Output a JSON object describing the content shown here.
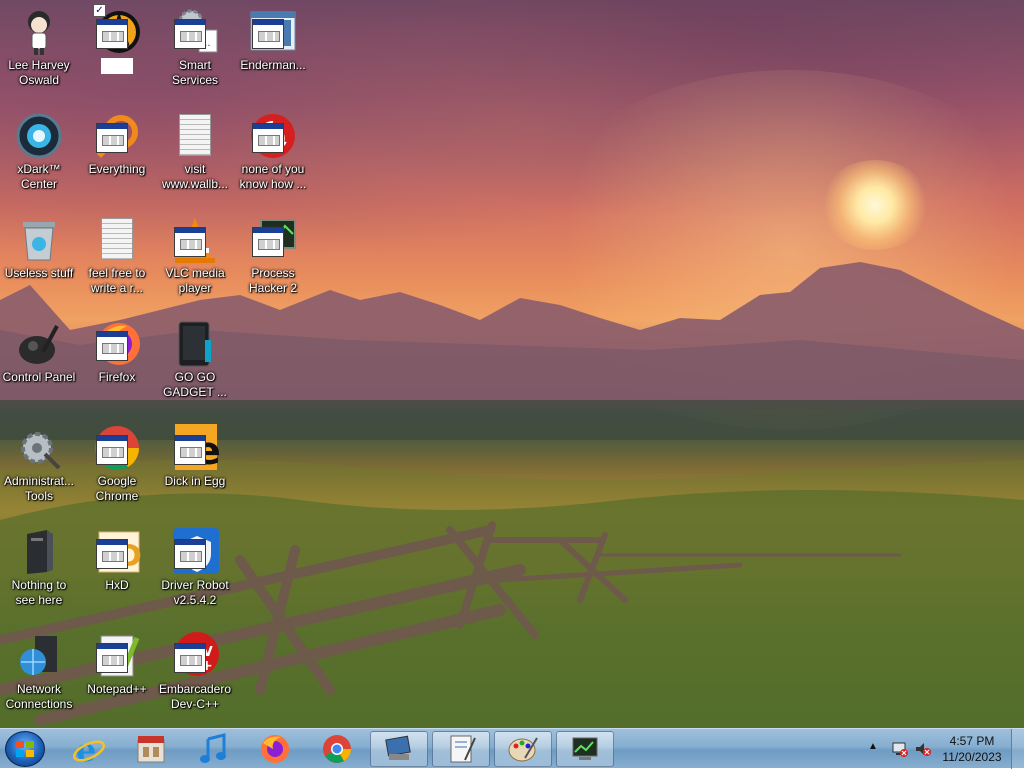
{
  "desktop_icons": [
    {
      "name": "desktop-icon-lee-harvey-oswald",
      "label": "Lee Harvey\nOswald",
      "icon": "anime-character-icon"
    },
    {
      "name": "desktop-icon-unnamed",
      "label": "",
      "icon": "half-life-app-icon"
    },
    {
      "name": "desktop-icon-smart-services",
      "label": "Smart\nServices",
      "icon": "gears-app-icon"
    },
    {
      "name": "desktop-icon-enderman",
      "label": "Enderman...",
      "icon": "window-app-icon"
    },
    {
      "name": "desktop-icon-xdark-center",
      "label": "xDark™\nCenter",
      "icon": "xdark-orb-icon"
    },
    {
      "name": "desktop-icon-everything",
      "label": "Everything",
      "icon": "search-magnifier-icon"
    },
    {
      "name": "desktop-icon-visit-wallb",
      "label": "visit\nwww.wallb...",
      "icon": "text-document-icon"
    },
    {
      "name": "desktop-icon-none-of-you",
      "label": "none of you\nknow how ...",
      "icon": "red-app-icon"
    },
    {
      "name": "desktop-icon-useless-stuff",
      "label": "Useless stuff",
      "icon": "recycle-bin-icon"
    },
    {
      "name": "desktop-icon-feel-free",
      "label": "feel free to\nwrite a r...",
      "icon": "text-document-icon"
    },
    {
      "name": "desktop-icon-vlc",
      "label": "VLC media\nplayer",
      "icon": "vlc-cone-icon"
    },
    {
      "name": "desktop-icon-process-hacker",
      "label": "Process\nHacker 2",
      "icon": "monitor-app-icon"
    },
    {
      "name": "desktop-icon-control-panel",
      "label": "Control Panel",
      "icon": "control-panel-icon"
    },
    {
      "name": "desktop-icon-firefox",
      "label": "Firefox",
      "icon": "firefox-icon"
    },
    {
      "name": "desktop-icon-go-go-gadget",
      "label": "GO GO\nGADGET ...",
      "icon": "gadget-box-icon"
    },
    {
      "name": "desktop-icon-admin-tools",
      "label": "Administrat...\nTools",
      "icon": "admin-gears-icon"
    },
    {
      "name": "desktop-icon-google-chrome",
      "label": "Google\nChrome",
      "icon": "chrome-icon"
    },
    {
      "name": "desktop-icon-dick-in-egg",
      "label": "Dick in Egg",
      "icon": "letter-e-app-icon"
    },
    {
      "name": "desktop-icon-nothing-to-see",
      "label": "Nothing to\nsee here",
      "icon": "pc-tower-icon"
    },
    {
      "name": "desktop-icon-hxd",
      "label": "HxD",
      "icon": "hxd-app-icon"
    },
    {
      "name": "desktop-icon-driver-robot",
      "label": "Driver Robot\nv2.5.4.2",
      "icon": "shield-app-icon"
    },
    {
      "name": "desktop-icon-network-connections",
      "label": "Network\nConnections",
      "icon": "network-globe-icon"
    },
    {
      "name": "desktop-icon-notepad-plus",
      "label": "Notepad++",
      "icon": "notepad-plus-icon"
    },
    {
      "name": "desktop-icon-embarcadero",
      "label": "Embarcadero\nDev-C++",
      "icon": "dev-cpp-icon"
    }
  ],
  "taskbar": {
    "pinned": [
      {
        "name": "taskbar-internet-explorer",
        "icon": "internet-explorer-icon"
      },
      {
        "name": "taskbar-app-store",
        "icon": "store-icon"
      },
      {
        "name": "taskbar-music",
        "icon": "music-note-icon"
      },
      {
        "name": "taskbar-firefox",
        "icon": "firefox-icon"
      },
      {
        "name": "taskbar-chrome",
        "icon": "chrome-icon"
      },
      {
        "name": "taskbar-window-1",
        "icon": "computer-app-icon"
      },
      {
        "name": "taskbar-window-2",
        "icon": "notepad-app-icon"
      },
      {
        "name": "taskbar-window-3",
        "icon": "paint-icon"
      },
      {
        "name": "taskbar-window-4",
        "icon": "monitor-app-icon"
      }
    ],
    "clock_time": "4:57 PM",
    "clock_date": "11/20/2023"
  },
  "colors": {
    "taskbar": "#86aed0",
    "label_text": "#ffffff"
  }
}
